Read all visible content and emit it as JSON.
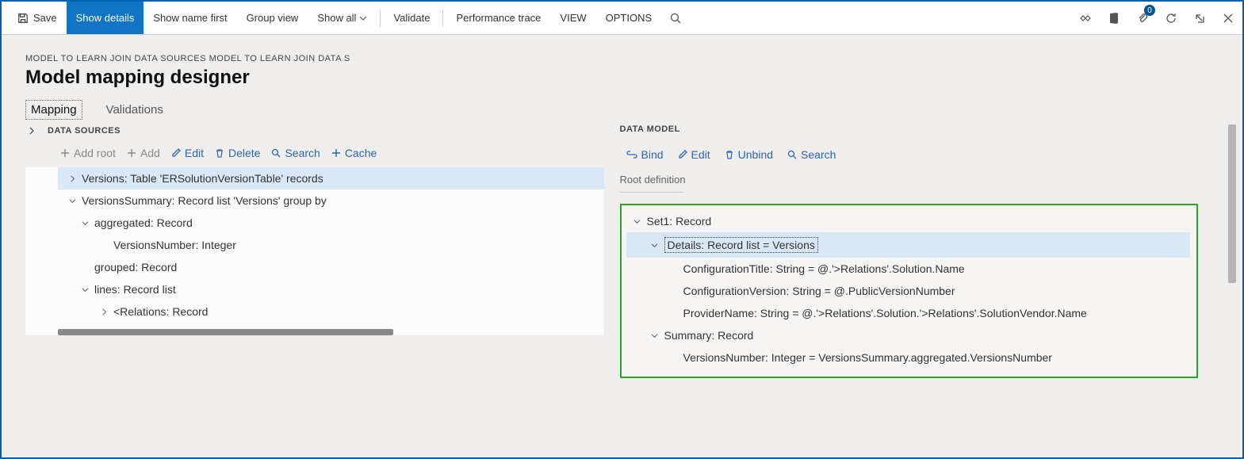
{
  "toolbar": {
    "save": "Save",
    "show_details": "Show details",
    "show_name_first": "Show name first",
    "group_view": "Group view",
    "show_all": "Show all",
    "validate": "Validate",
    "perf_trace": "Performance trace",
    "view": "VIEW",
    "options": "OPTIONS",
    "badge_count": "0"
  },
  "breadcrumb": "MODEL TO LEARN JOIN DATA SOURCES MODEL TO LEARN JOIN DATA S",
  "title": "Model mapping designer",
  "tabs": {
    "mapping": "Mapping",
    "validations": "Validations"
  },
  "ds": {
    "header": "DATA SOURCES",
    "add_root": "Add root",
    "add": "Add",
    "edit": "Edit",
    "delete": "Delete",
    "search": "Search",
    "cache": "Cache",
    "n0": "Versions: Table 'ERSolutionVersionTable' records",
    "n1": "VersionsSummary: Record list 'Versions' group by",
    "n2": "aggregated: Record",
    "n3": "VersionsNumber: Integer",
    "n4": "grouped: Record",
    "n5": "lines: Record list",
    "n6": "<Relations: Record"
  },
  "dm": {
    "header": "DATA MODEL",
    "bind": "Bind",
    "edit": "Edit",
    "unbind": "Unbind",
    "search": "Search",
    "rootdef": "Root definition",
    "m0": "Set1: Record",
    "m1": "Details: Record list = Versions",
    "m2": "ConfigurationTitle: String = @.'>Relations'.Solution.Name",
    "m3": "ConfigurationVersion: String = @.PublicVersionNumber",
    "m4": "ProviderName: String = @.'>Relations'.Solution.'>Relations'.SolutionVendor.Name",
    "m5": "Summary: Record",
    "m6": "VersionsNumber: Integer = VersionsSummary.aggregated.VersionsNumber"
  }
}
